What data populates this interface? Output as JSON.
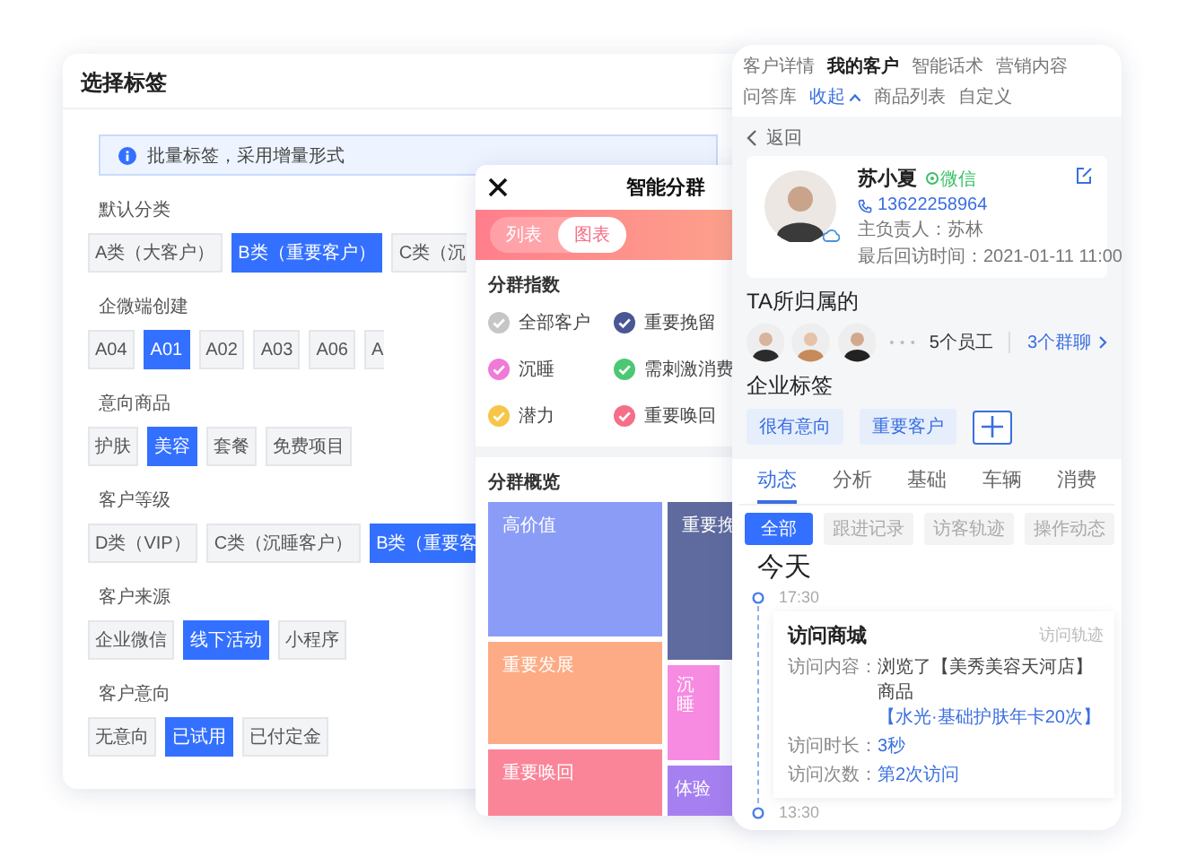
{
  "tag_dialog": {
    "title": "选择标签",
    "notice": "批量标签，采用增量形式",
    "groups": [
      {
        "label": "默认分类",
        "options": [
          {
            "label": "A类（大客户）",
            "selected": false
          },
          {
            "label": "B类（重要客户）",
            "selected": true
          },
          {
            "label": "C类（沉",
            "selected": false,
            "cut": true
          }
        ]
      },
      {
        "label": "企微端创建",
        "options": [
          {
            "label": "A04",
            "selected": false
          },
          {
            "label": "A01",
            "selected": true
          },
          {
            "label": "A02",
            "selected": false
          },
          {
            "label": "A03",
            "selected": false
          },
          {
            "label": "A06",
            "selected": false
          },
          {
            "label": "A",
            "selected": false,
            "cut": true
          }
        ]
      },
      {
        "label": "意向商品",
        "options": [
          {
            "label": "护肤",
            "selected": false
          },
          {
            "label": "美容",
            "selected": true
          },
          {
            "label": "套餐",
            "selected": false
          },
          {
            "label": "免费项目",
            "selected": false
          }
        ]
      },
      {
        "label": "客户等级",
        "options": [
          {
            "label": "D类（VIP）",
            "selected": false
          },
          {
            "label": "C类（沉睡客户）",
            "selected": false
          },
          {
            "label": "B类（重要客",
            "selected": true,
            "cut": true
          }
        ]
      },
      {
        "label": "客户来源",
        "options": [
          {
            "label": "企业微信",
            "selected": false
          },
          {
            "label": "线下活动",
            "selected": true
          },
          {
            "label": "小程序",
            "selected": false
          }
        ]
      },
      {
        "label": "客户意向",
        "options": [
          {
            "label": "无意向",
            "selected": false
          },
          {
            "label": "已试用",
            "selected": true
          },
          {
            "label": "已付定金",
            "selected": false
          }
        ]
      }
    ]
  },
  "smart_group": {
    "title": "智能分群",
    "view_toggle": [
      {
        "label": "列表",
        "selected": false
      },
      {
        "label": "图表",
        "selected": true
      }
    ],
    "index_title": "分群指数",
    "indexes": [
      {
        "label": "全部客户",
        "color": "#c6c6c6",
        "checked": true
      },
      {
        "label": "重要挽留",
        "color": "#4b5694",
        "checked": true
      },
      {
        "label": "沉睡",
        "color": "#f07ad8",
        "checked": true
      },
      {
        "label": "需刺激消费",
        "color": "#4cc873",
        "checked": true
      },
      {
        "label": "潜力",
        "color": "#f7c548",
        "checked": true
      },
      {
        "label": "重要唤回",
        "color": "#f56f88",
        "checked": true
      }
    ],
    "overview_title": "分群概览",
    "columns": [
      {
        "tiles": [
          {
            "label": "高价值",
            "color": "#8a9cf5"
          },
          {
            "label": "重要发展",
            "color": "#fdab84"
          },
          {
            "label": "重要唤回",
            "color": "#fa8498"
          }
        ]
      },
      {
        "tiles": [
          {
            "label": "重要挽",
            "color": "#5f6b9e"
          },
          {
            "label": "沉睡",
            "color": "#f78be2"
          },
          {
            "label": "体验",
            "color": "#a680f1"
          }
        ]
      }
    ]
  },
  "customer_panel": {
    "tabs": [
      {
        "label": "客户详情",
        "selected": false
      },
      {
        "label": "我的客户",
        "selected": true
      },
      {
        "label": "智能话术",
        "selected": false
      },
      {
        "label": "营销内容",
        "selected": false
      },
      {
        "label": "问答库",
        "selected": false
      },
      {
        "label": "商品列表",
        "selected": false
      },
      {
        "label": "自定义",
        "selected": false
      }
    ],
    "collapse": "收起",
    "back": "返回",
    "profile": {
      "name": "苏小夏",
      "channel": "微信",
      "phone": "13622258964",
      "owner": "主负责人：苏林",
      "last_visit": "最后回访时间：2021-01-11 11:00"
    },
    "belongs_title": "TA所归属的",
    "staff_count": "5个员工",
    "group_count": "3个群聊",
    "tags_title": "企业标签",
    "tags": [
      "很有意向",
      "重要客户"
    ],
    "detail_tabs": [
      {
        "label": "动态",
        "selected": true
      },
      {
        "label": "分析",
        "selected": false
      },
      {
        "label": "基础",
        "selected": false
      },
      {
        "label": "车辆",
        "selected": false
      },
      {
        "label": "消费",
        "selected": false
      }
    ],
    "filters": [
      {
        "label": "全部",
        "selected": true
      },
      {
        "label": "跟进记录",
        "selected": false
      },
      {
        "label": "访客轨迹",
        "selected": false
      },
      {
        "label": "操作动态",
        "selected": false
      }
    ],
    "day": "今天",
    "timeline": [
      {
        "time": "17:30",
        "card": {
          "title": "访问商城",
          "type": "访问轨迹",
          "rows": [
            {
              "label": "访问内容：",
              "value": "浏览了【美秀美容天河店】商品",
              "highlight": "【水光·基础护肤年卡20次】"
            },
            {
              "label": "访问时长：",
              "highlight": "3秒"
            },
            {
              "label": "访问次数：",
              "highlight": "第2次访问"
            }
          ]
        }
      },
      {
        "time": "13:30"
      }
    ]
  }
}
